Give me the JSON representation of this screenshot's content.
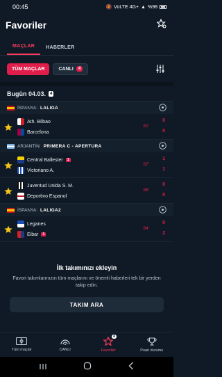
{
  "status": {
    "time": "00:45",
    "battery": "%98",
    "network": "VoLTE 4G+"
  },
  "header": {
    "title": "Favoriler"
  },
  "tabs": [
    {
      "label": "MAÇLAR"
    },
    {
      "label": "HABERLER"
    }
  ],
  "filters": {
    "all": "TÜM MAÇLAR",
    "live": "CANLI",
    "live_count": "4"
  },
  "date": {
    "label": "Bugün 04.03.",
    "count": "4"
  },
  "leagues": [
    {
      "country": "İSPANYA:",
      "name": "LALIGA",
      "matches": [
        {
          "home": "Ath. Bilbao",
          "away": "Barcelona",
          "minute": "81'",
          "home_score": "0",
          "away_score": "0",
          "home_cards": "",
          "away_cards": ""
        }
      ]
    },
    {
      "country": "ARJANTİN:",
      "name": "PRIMERA C - APERTURA",
      "matches": [
        {
          "home": "Central Ballester",
          "away": "Victoriano A.",
          "minute": "87'",
          "home_score": "1",
          "away_score": "1",
          "home_cards": "1",
          "away_cards": ""
        },
        {
          "home": "Juventud Unida S. M.",
          "away": "Deportivo Espanol",
          "minute": "86'",
          "home_score": "0",
          "away_score": "0",
          "home_cards": "",
          "away_cards": ""
        }
      ]
    },
    {
      "country": "İSPANYA:",
      "name": "LALIGA2",
      "matches": [
        {
          "home": "Leganes",
          "away": "Eibar",
          "minute": "84'",
          "home_score": "0",
          "away_score": "2",
          "home_cards": "",
          "away_cards": "1"
        }
      ]
    }
  ],
  "promo": {
    "title": "İlk takımınızı ekleyin",
    "text": "Favori takımlarınızın tüm maçlarını ve önemli haberleri tek bir yerden takip edin.",
    "button": "TAKIM ARA"
  },
  "nav": [
    {
      "label": "Tüm maçlar"
    },
    {
      "label": "CANLI"
    },
    {
      "label": "Favoriler",
      "badge": "4"
    },
    {
      "label": "Puan durumu"
    }
  ],
  "colors": {
    "accent": "#e01e4b",
    "background": "#0f1a26"
  }
}
